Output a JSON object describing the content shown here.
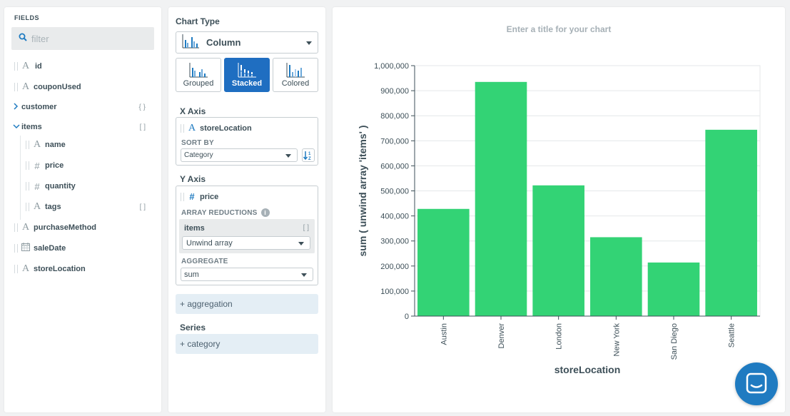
{
  "fields_panel": {
    "title": "FIELDS",
    "filter_placeholder": "filter",
    "fields": [
      {
        "name": "id",
        "type": "string-icon"
      },
      {
        "name": "couponUsed",
        "type": "string-icon"
      },
      {
        "name": "customer",
        "type": "object",
        "bracket": "{ }"
      },
      {
        "name": "items",
        "type": "array",
        "bracket": "[ ]"
      },
      {
        "name": "name",
        "type": "string-icon"
      },
      {
        "name": "price",
        "type": "number-icon"
      },
      {
        "name": "quantity",
        "type": "number-icon"
      },
      {
        "name": "tags",
        "type": "string-icon",
        "bracket": "[ ]"
      },
      {
        "name": "purchaseMethod",
        "type": "string-icon"
      },
      {
        "name": "saleDate",
        "type": "date-icon"
      },
      {
        "name": "storeLocation",
        "type": "string-icon"
      }
    ]
  },
  "config_panel": {
    "chart_type_label": "Chart Type",
    "chart_type_value": "Column",
    "subtypes": [
      "Grouped",
      "Stacked",
      "Colored"
    ],
    "x_axis": {
      "label": "X Axis",
      "field": "storeLocation",
      "sort_by_label": "SORT BY",
      "sort_by_value": "Category"
    },
    "y_axis": {
      "label": "Y Axis",
      "field": "price",
      "array_reductions_label": "ARRAY REDUCTIONS",
      "reduction_field": "items",
      "reduction_bracket": "[ ]",
      "reduction_value": "Unwind array",
      "aggregate_label": "AGGREGATE",
      "aggregate_value": "sum"
    },
    "add_aggregation": "+ aggregation",
    "series_label": "Series",
    "add_category": "+ category"
  },
  "chart_panel": {
    "title_placeholder": "Enter a title for your chart"
  },
  "chart_data": {
    "type": "bar",
    "title": "",
    "xlabel": "storeLocation",
    "ylabel": "sum ( unwind array 'items' )",
    "categories": [
      "Austin",
      "Denver",
      "London",
      "New York",
      "San Diego",
      "Seattle"
    ],
    "values": [
      428000,
      935000,
      522000,
      315000,
      214000,
      744000
    ],
    "ylim": [
      0,
      1000000
    ],
    "yticks": [
      "0",
      "100,000",
      "200,000",
      "300,000",
      "400,000",
      "500,000",
      "600,000",
      "700,000",
      "800,000",
      "900,000",
      "1,000,000"
    ],
    "bar_color": "#33d375",
    "grid": true
  }
}
